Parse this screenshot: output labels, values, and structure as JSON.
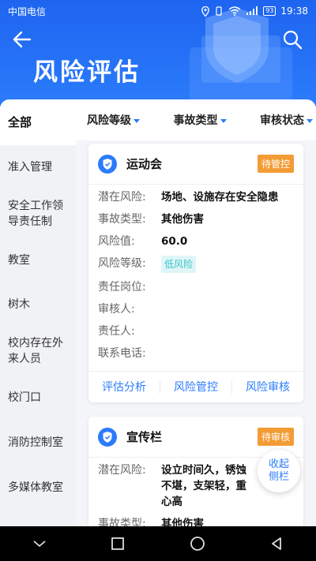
{
  "status_bar": {
    "carrier": "中国电信",
    "battery": "93",
    "time": "19:38",
    "signal": "4G"
  },
  "header": {
    "title": "风险评估",
    "back_icon": "arrow-left-icon",
    "search_icon": "search-icon"
  },
  "sidebar": {
    "items": [
      {
        "label": "全部",
        "active": true
      },
      {
        "label": "准入管理"
      },
      {
        "label": "安全工作领导责任制"
      },
      {
        "label": "教室"
      },
      {
        "label": "树木"
      },
      {
        "label": "校内存在外来人员"
      },
      {
        "label": "校门口"
      },
      {
        "label": "消防控制室"
      },
      {
        "label": "多媒体教室"
      }
    ]
  },
  "filters": [
    {
      "label": "风险等级"
    },
    {
      "label": "事故类型"
    },
    {
      "label": "审核状态"
    }
  ],
  "cards": [
    {
      "title": "运动会",
      "status": "待管控",
      "fields": {
        "risk_label": "潜在风险:",
        "risk": "场地、设施存在安全隐患",
        "type_label": "事故类型:",
        "type": "其他伤害",
        "value_label": "风险值:",
        "value": "60.0",
        "level_label": "风险等级:",
        "level": "低风险",
        "post_label": "责任岗位:",
        "post": "",
        "reviewer_label": "审核人:",
        "reviewer": "",
        "owner_label": "责任人:",
        "owner": "",
        "phone_label": "联系电话:",
        "phone": ""
      },
      "actions": [
        "评估分析",
        "风险管控",
        "风险审核"
      ]
    },
    {
      "title": "宣传栏",
      "status": "待审核",
      "fields": {
        "risk_label": "潜在风险:",
        "risk": "设立时间久，锈蚀不堪，支架轻，重心高",
        "type_label": "事故类型:",
        "type": "其他伤害"
      }
    }
  ],
  "collapse_button": "收起侧栏",
  "colors": {
    "primary": "#2b7cfb",
    "badge": "#f39c35",
    "level_bg": "#dff6f7",
    "level_text": "#39c4cc"
  }
}
